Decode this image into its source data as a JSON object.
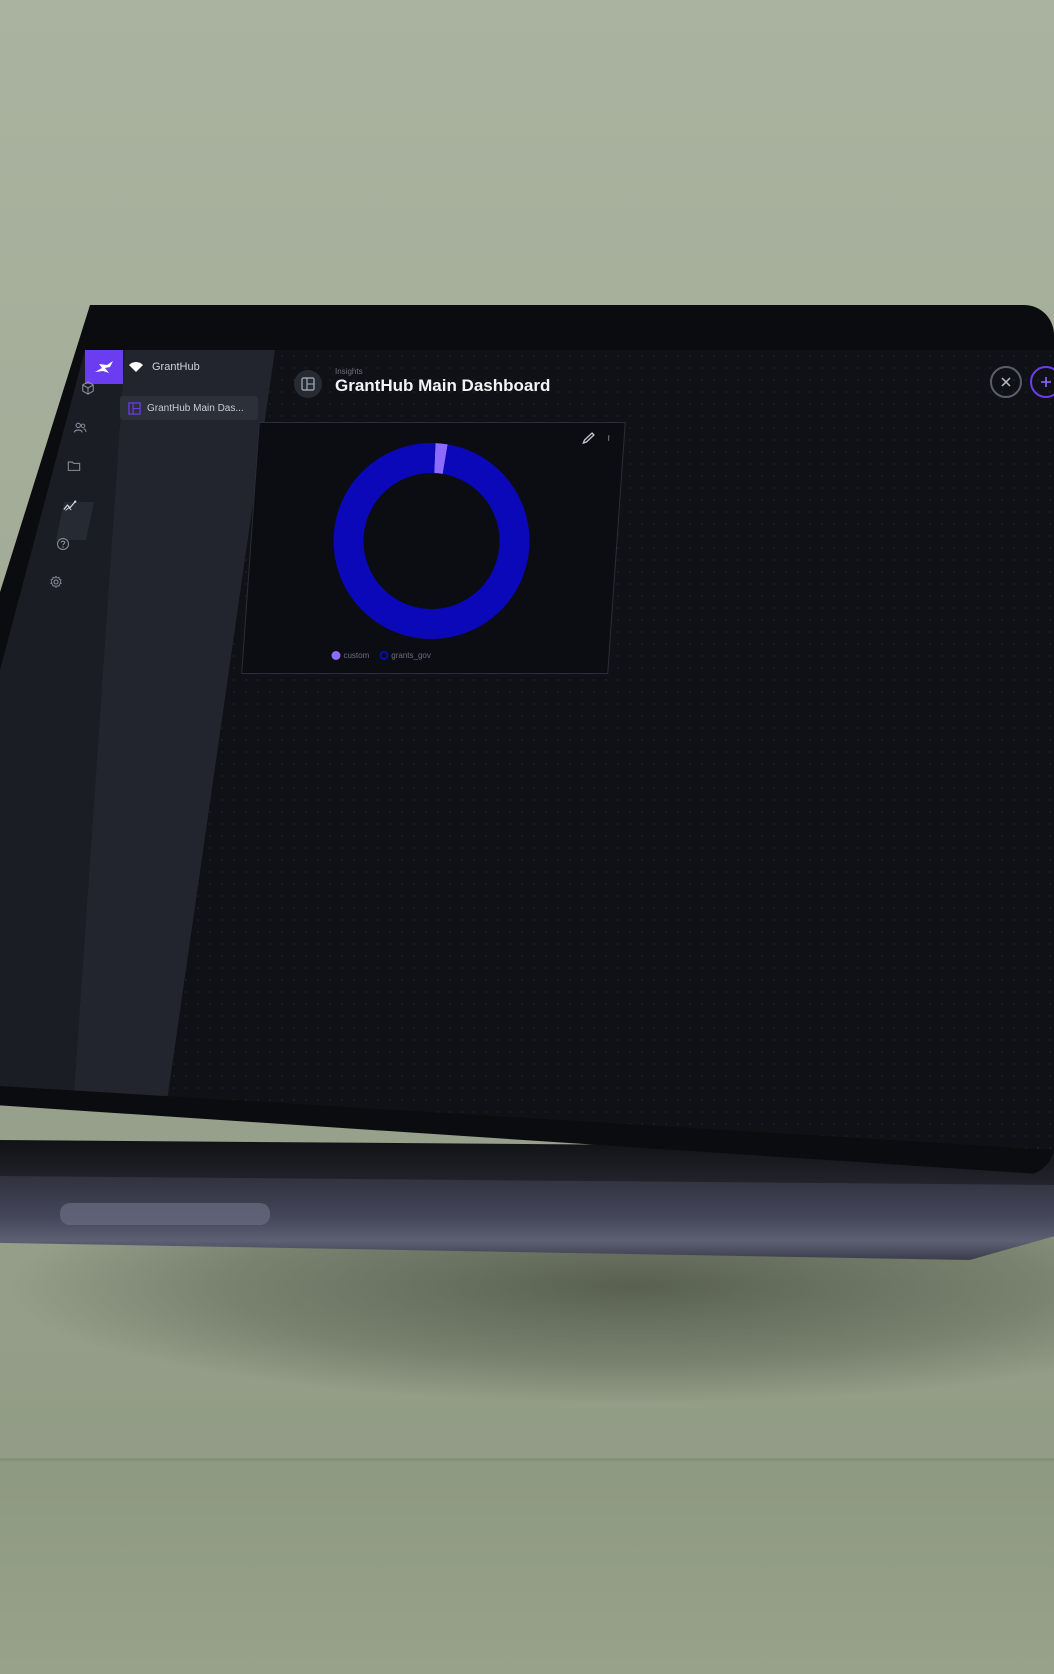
{
  "app": {
    "workspace_name": "GrantHub",
    "accent_color": "#6a3df0"
  },
  "rail": {
    "icons": [
      "logo-icon",
      "cube-icon",
      "users-icon",
      "folder-icon",
      "insights-icon",
      "help-icon",
      "settings-icon"
    ],
    "active": "insights-icon"
  },
  "nav": {
    "items": [
      {
        "label": "GrantHub Main Das..."
      }
    ]
  },
  "header": {
    "breadcrumb": "Insights",
    "title": "GrantHub Main Dashboard"
  },
  "chart_data": {
    "type": "pie",
    "donut": true,
    "title": "",
    "slices": [
      {
        "name": "custom",
        "value": 2,
        "color": "#8e6bff"
      },
      {
        "name": "grants_gov",
        "value": 98,
        "color": "#0a08b8"
      }
    ],
    "legend_placement": "bottom"
  }
}
